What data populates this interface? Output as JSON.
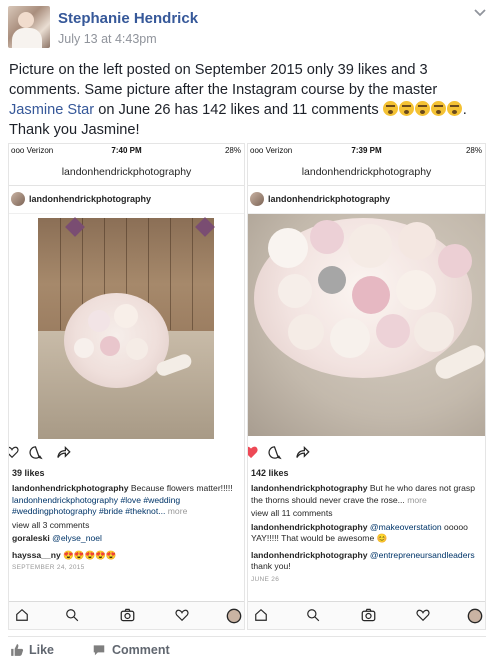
{
  "post": {
    "author": "Stephanie Hendrick",
    "timestamp": "July 13 at 4:43pm",
    "text_part1": "Picture on the left posted on September 2015 only 39 likes and 3 comments. Same picture after the Instagram course by the master ",
    "link_text": "Jasmine Star",
    "text_part2": " on June 26 has 142 likes and 11 comments ",
    "text_part3": ". Thank you Jasmine!"
  },
  "left_phone": {
    "carrier": "ooo Verizon",
    "time": "7:40 PM",
    "battery": "28%",
    "title": "landonhendrickphotography",
    "username": "landonhendrickphotography",
    "likes": "39 likes",
    "caption_user": "landonhendrickphotography",
    "caption_text": " Because flowers matter!!!!!",
    "caption_tags": "landonhendrickphotography #love #wedding #weddingphotography #bride #theknot...",
    "caption_more": " more",
    "view_comments": "view all 3 comments",
    "comment1_user": "goraleski",
    "comment1_text": " @elyse_noel",
    "comment2_user": "hayssa__ny",
    "comment2_text": " 😍😍😍😍😍",
    "date": "SEPTEMBER 24, 2015"
  },
  "right_phone": {
    "carrier": "ooo Verizon",
    "time": "7:39 PM",
    "battery": "28%",
    "title": "landonhendrickphotography",
    "username": "landonhendrickphotography",
    "likes": "142 likes",
    "caption_user": "landonhendrickphotography",
    "caption_text": " But he who dares not grasp the thorns should never crave the rose...",
    "caption_more": " more",
    "view_comments": "view all 11 comments",
    "comment1_user": "landonhendrickphotography",
    "comment1_tag": " @makeoverstation",
    "comment1_text": " ooooo YAY!!!!! That would be awesome 😊",
    "comment2_user": "landonhendrickphotography",
    "comment2_tag": " @entrepreneursandleaders",
    "comment2_text": " thank you!",
    "date": "JUNE 26"
  },
  "footer": {
    "like_label": "Like",
    "comment_label": "Comment"
  },
  "colors": {
    "link": "#365899",
    "meta": "#90949c",
    "like_red": "#ed4956"
  },
  "icons": [
    "chevron-down-icon",
    "heart-icon",
    "comment-icon",
    "share-icon",
    "home-icon",
    "search-icon",
    "camera-icon",
    "activity-icon",
    "profile-icon",
    "thumbs-up-icon",
    "speech-bubble-icon"
  ]
}
